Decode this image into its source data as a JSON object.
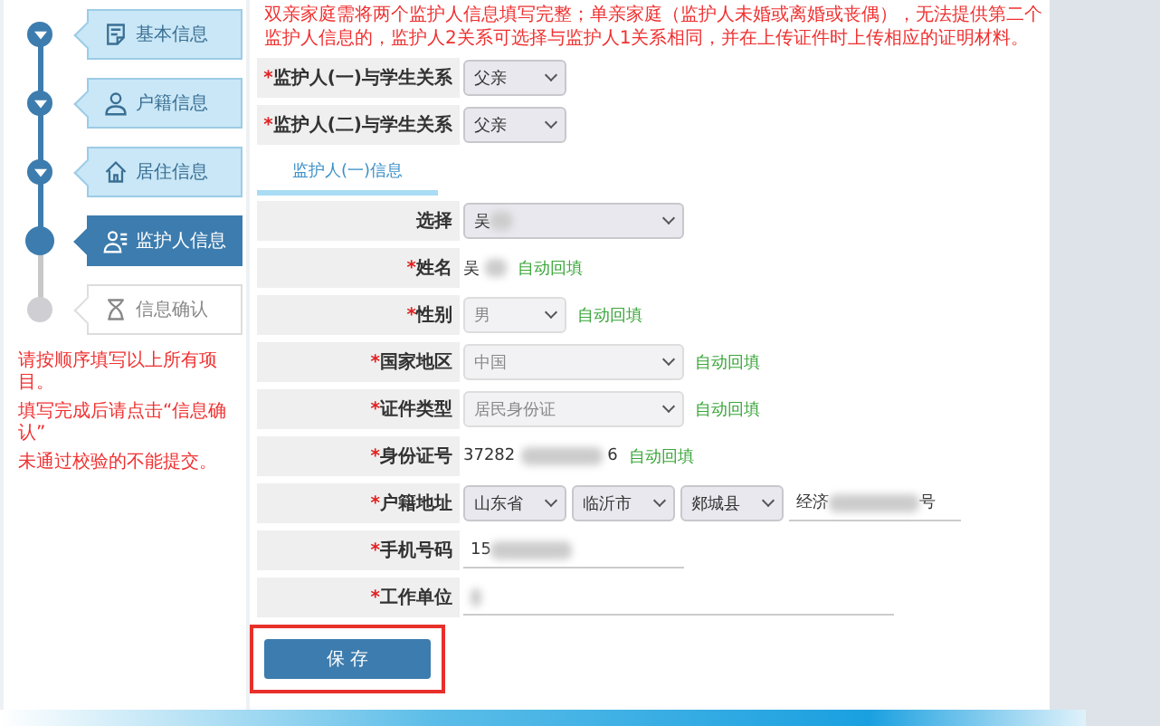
{
  "steps": [
    {
      "label": "基本信息",
      "completed": true,
      "selected": false
    },
    {
      "label": "户籍信息",
      "completed": true,
      "selected": false
    },
    {
      "label": "居住信息",
      "completed": true,
      "selected": false
    },
    {
      "label": "监护人信息",
      "completed": false,
      "selected": true
    },
    {
      "label": "信息确认",
      "completed": false,
      "selected": false
    }
  ],
  "sidebar_notes": [
    "请按顺序填写以上所有项目。",
    "填写完成后请点击“信息确认”",
    "未通过校验的不能提交。"
  ],
  "notice": "双亲家庭需将两个监护人信息填写完整；单亲家庭（监护人未婚或离婚或丧偶），无法提供第二个监护人信息的，监护人2关系可选择与监护人1关系相同，并在上传证件时上传相应的证明材料。",
  "relations": [
    {
      "mark": "*",
      "label": "监护人(一)与学生关系",
      "value": "父亲"
    },
    {
      "mark": "*",
      "label": "监护人(二)与学生关系",
      "value": "父亲"
    }
  ],
  "section_tab": {
    "label": "监护人(一)信息",
    "selected": true
  },
  "fields": [
    {
      "kind": "select",
      "label": "选择",
      "value": "吴",
      "blurred": true,
      "disabled": false
    },
    {
      "kind": "text",
      "mark": "*",
      "label": "姓名",
      "value": "吴",
      "blurred": true,
      "hint": "自动回填"
    },
    {
      "kind": "select",
      "mark": "*",
      "label": "性别",
      "value": "男",
      "disabled": true,
      "hint": "自动回填"
    },
    {
      "kind": "select",
      "mark": "*",
      "label": "国家地区",
      "value": "中国",
      "disabled": true,
      "hint": "自动回填"
    },
    {
      "kind": "select",
      "mark": "*",
      "label": "证件类型",
      "value": "居民身份证",
      "disabled": true,
      "hint": "自动回填"
    },
    {
      "kind": "text",
      "mark": "*",
      "label": "身份证号",
      "value": "37282",
      "blurred": true,
      "tail": "6",
      "hint": "自动回填"
    },
    {
      "kind": "address",
      "mark": "*",
      "label": "户籍地址",
      "parts": [
        "山东省",
        "临沂市",
        "郯城县"
      ],
      "detail": "经济",
      "detail_tail": "号"
    },
    {
      "kind": "input",
      "mark": "*",
      "label": "手机号码",
      "value": "15",
      "blurred": true
    },
    {
      "kind": "input",
      "mark": "*",
      "label": "工作单位",
      "blurred": true
    }
  ],
  "save_button": "保 存"
}
